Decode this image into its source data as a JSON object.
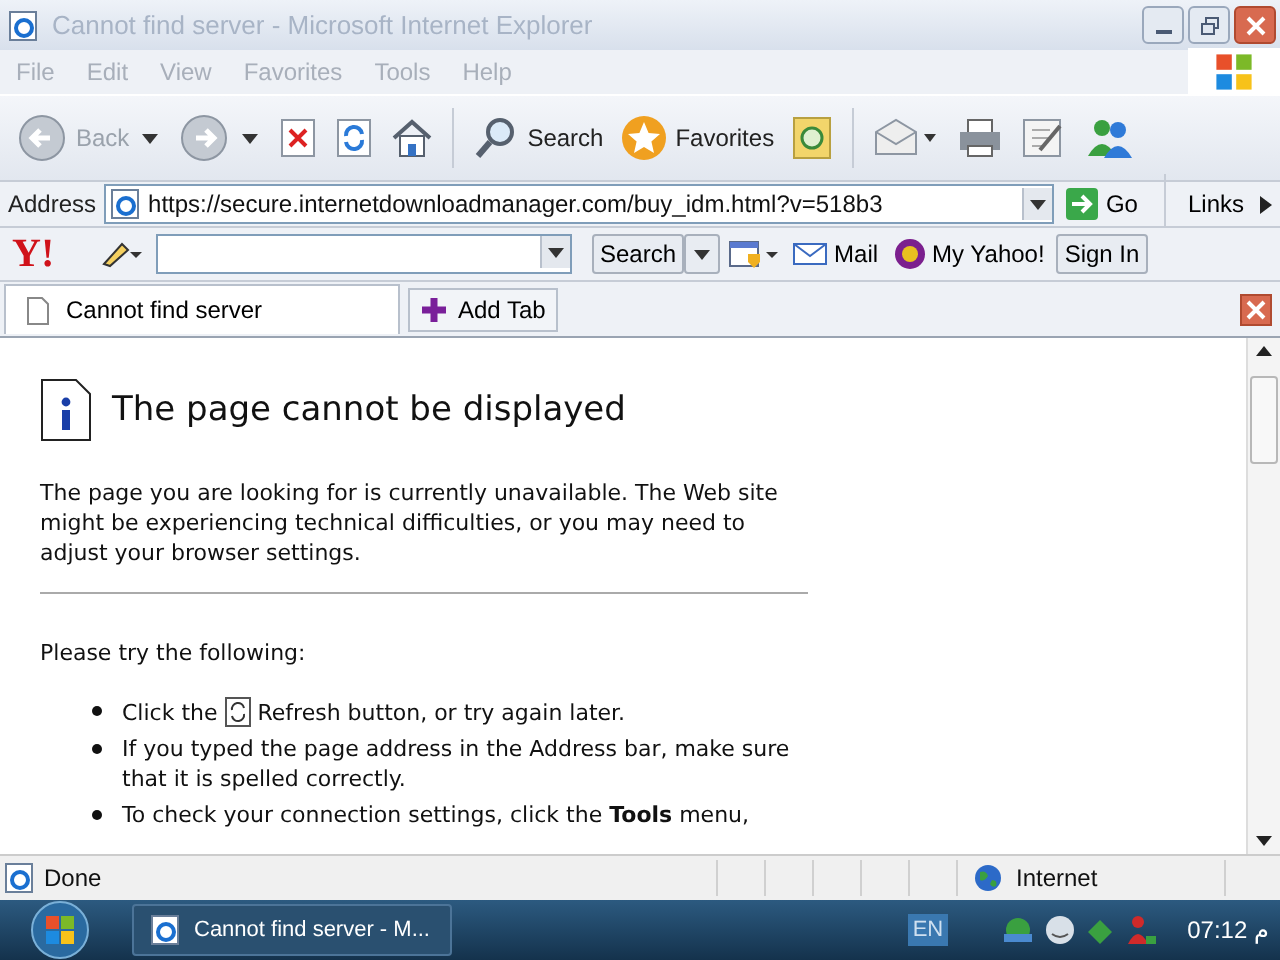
{
  "window": {
    "title": "Cannot find server - Microsoft Internet Explorer",
    "active": false
  },
  "menu": [
    "File",
    "Edit",
    "View",
    "Favorites",
    "Tools",
    "Help"
  ],
  "toolbar": [
    {
      "kind": "back",
      "label": "Back",
      "disabled": true
    },
    {
      "kind": "forward",
      "disabled": true
    },
    {
      "kind": "stop"
    },
    {
      "kind": "refresh"
    },
    {
      "kind": "home"
    },
    {
      "kind": "search",
      "label": "Search"
    },
    {
      "kind": "favorites",
      "label": "Favorites"
    },
    {
      "kind": "history"
    },
    {
      "kind": "mail"
    },
    {
      "kind": "print"
    },
    {
      "kind": "edit"
    },
    {
      "kind": "messenger"
    }
  ],
  "address": {
    "label": "Address",
    "url": "https://secure.internetdownloadmanager.com/buy_idm.html?v=518b3",
    "go": "Go",
    "links": "Links"
  },
  "yahoo": {
    "logo": "Y!",
    "search": "Search",
    "mail": "Mail",
    "my_yahoo": "My Yahoo!",
    "sign_in": "Sign In"
  },
  "tabs": [
    {
      "label": "Cannot find server",
      "selected": true
    }
  ],
  "add_tab": "Add Tab",
  "page": {
    "heading": "The page cannot be displayed",
    "intro": "The page you are looking for is currently unavailable. The Web site might be experiencing technical difficulties, or you may need to adjust your browser settings.",
    "try": "Please try the following:",
    "bullets": [
      {
        "kind": "refresh",
        "before": "Click the",
        "after": "Refresh button, or try again later."
      },
      {
        "kind": "text",
        "text": "If you typed the page address in the Address bar, make sure that it is spelled correctly."
      },
      {
        "kind": "text",
        "text": "To check your connection settings, click the **Tools** menu,"
      }
    ]
  },
  "status": {
    "text": "Done",
    "zone": "Internet"
  },
  "taskbar": {
    "task": "Cannot find server - M...",
    "language": "EN",
    "time": "07:12 م"
  }
}
